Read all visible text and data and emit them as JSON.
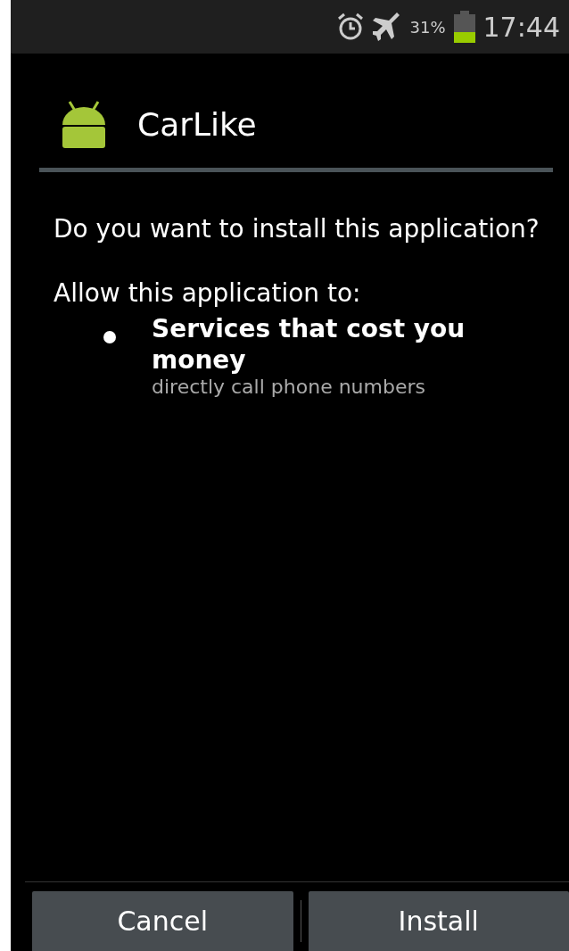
{
  "status_bar": {
    "battery": "31%",
    "time": "17:44"
  },
  "app": {
    "name": "CarLike"
  },
  "question": "Do you want to install this application?",
  "permissions_heading": "Allow this application to:",
  "permissions": [
    {
      "title": "Services that cost you money",
      "detail": "directly call phone numbers"
    }
  ],
  "buttons": [
    "Cancel",
    "Install"
  ]
}
